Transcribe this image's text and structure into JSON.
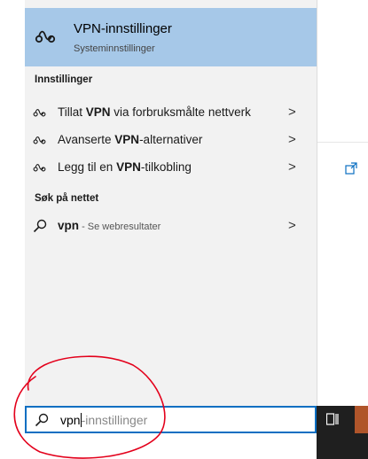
{
  "top_result": {
    "title": "VPN-innstillinger",
    "subtitle": "Systeminnstillinger",
    "icon": "vpn-icon"
  },
  "settings_section": {
    "header": "Innstillinger",
    "items": [
      {
        "pre": "Tillat ",
        "bold": "VPN",
        "post": " via forbruksmålte nettverk",
        "icon": "vpn-icon"
      },
      {
        "pre": "Avanserte ",
        "bold": "VPN",
        "post": "-alternativer",
        "icon": "vpn-icon"
      },
      {
        "pre": "Legg til en ",
        "bold": "VPN",
        "post": "-tilkobling",
        "icon": "vpn-icon"
      }
    ]
  },
  "web_section": {
    "header": "Søk på nettet",
    "item": {
      "query": "vpn",
      "suffix": " - Se webresultater",
      "icon": "search-icon"
    }
  },
  "chevron": ">",
  "search_box": {
    "typed": "vpn",
    "suggestion": "-innstillinger"
  },
  "colors": {
    "selected": "#a6c8e8",
    "accent": "#0a6fc2",
    "taskbar": "#1f1f1f",
    "annotation": "#e3001b"
  }
}
